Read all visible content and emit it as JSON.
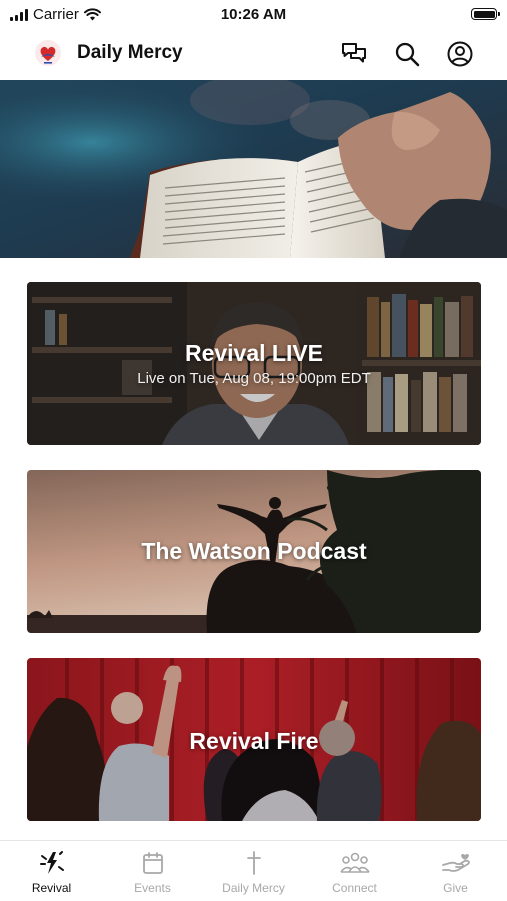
{
  "status_bar": {
    "carrier": "Carrier",
    "time": "10:26 AM"
  },
  "header": {
    "title": "Daily Mercy",
    "icons": [
      "chat-bubbles-icon",
      "search-icon",
      "profile-icon"
    ]
  },
  "cards": [
    {
      "title": "Revival LIVE",
      "subtitle": "Live on Tue, Aug 08, 19:00pm EDT"
    },
    {
      "title": "The Watson Podcast"
    },
    {
      "title": "Revival Fire"
    }
  ],
  "tab_bar": {
    "active": "Revival",
    "tabs": [
      {
        "label": "Revival",
        "icon": "revival-icon"
      },
      {
        "label": "Events",
        "icon": "calendar-icon"
      },
      {
        "label": "Daily Mercy",
        "icon": "cross-icon"
      },
      {
        "label": "Connect",
        "icon": "people-icon"
      },
      {
        "label": "Give",
        "icon": "give-hand-icon"
      }
    ]
  },
  "colors": {
    "active_tab": "#111111",
    "inactive_tab": "#a8a8a8",
    "logo_red": "#d42a2a",
    "logo_blue": "#2a4db0"
  }
}
